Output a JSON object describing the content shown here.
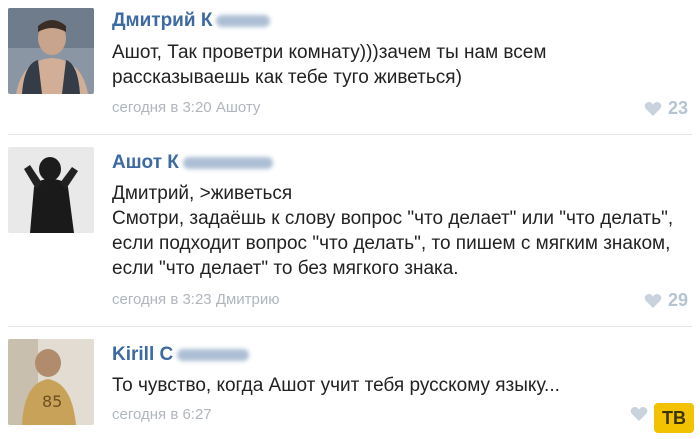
{
  "comments": [
    {
      "author": "Дмитрий К",
      "text": "Ашот, Так проветри комнату)))зачем ты нам всем\nрассказываешь как тебе туго живеться)",
      "meta": "сегодня в 3:20 Ашоту",
      "likes": "23"
    },
    {
      "author": "Ашот К",
      "text": "Дмитрий, >живеться\nСмотри, задаёшь к слову вопрос \"что делает\" или \"что делать\",\nесли подходит вопрос \"что делать\", то пишем с мягким знаком,\nесли \"что делает\" то без мягкого знака.",
      "meta": "сегодня в 3:23 Дмитрию",
      "likes": "29"
    },
    {
      "author": "Kirill C",
      "text": "То чувство, когда Ашот учит тебя русскому языку...",
      "meta": "сегодня в 6:27",
      "likes": ""
    }
  ],
  "watermark": "ТВ",
  "colors": {
    "author": "#3d6aa1",
    "meta": "#b0b6bd",
    "likes": "#b5c3d3",
    "divider": "#e3e6ea"
  }
}
